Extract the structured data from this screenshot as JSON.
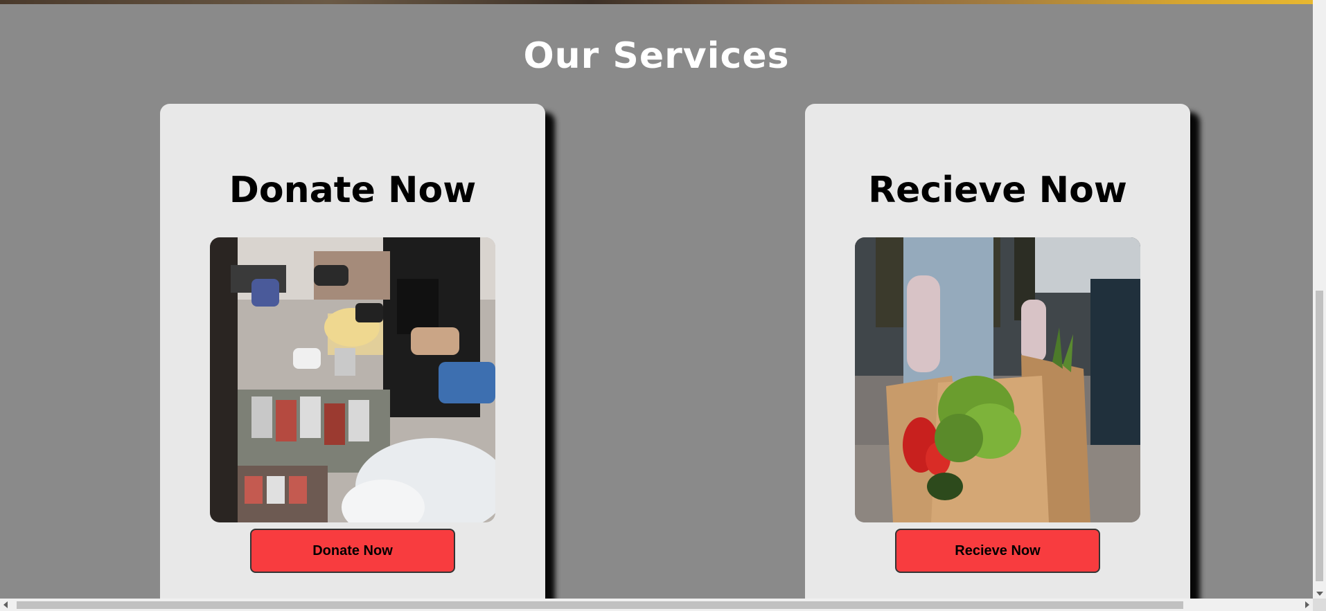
{
  "services": {
    "title": "Our Services",
    "cards": [
      {
        "title": "Donate Now",
        "image_subject": "volunteers-sorting-donated-food",
        "button_label": "Donate Now"
      },
      {
        "title": "Recieve Now",
        "image_subject": "hand-holding-grocery-bag",
        "button_label": "Recieve Now"
      }
    ]
  },
  "colors": {
    "page_background": "#8a8a8a",
    "card_background": "#e8e8e8",
    "button_background": "#f83c3f",
    "title_color": "#ffffff",
    "card_title_color": "#000000"
  },
  "scrollbars": {
    "vertical": "vertical-scrollbar",
    "horizontal": "horizontal-scrollbar"
  }
}
